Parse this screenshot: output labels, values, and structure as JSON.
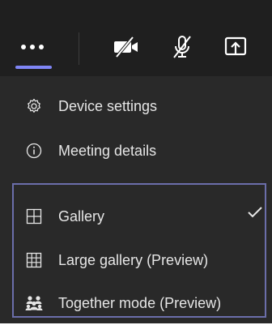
{
  "toolbar": {
    "more": {
      "icon": "more-horizontal-icon",
      "selected": true
    },
    "video": {
      "icon": "video-off-icon"
    },
    "mic": {
      "icon": "mic-off-icon"
    },
    "share": {
      "icon": "share-screen-icon"
    }
  },
  "menu": {
    "items": [
      {
        "label": "Device settings",
        "icon": "gear-icon"
      },
      {
        "label": "Meeting details",
        "icon": "info-icon"
      }
    ],
    "view_options": [
      {
        "label": "Gallery",
        "icon": "gallery-grid-icon",
        "checked": true
      },
      {
        "label": "Large gallery (Preview)",
        "icon": "large-gallery-grid-icon",
        "checked": false
      },
      {
        "label": "Together mode (Preview)",
        "icon": "together-mode-icon",
        "checked": false
      }
    ]
  },
  "colors": {
    "toolbar_bg": "#1f1f1f",
    "menu_bg": "#292929",
    "accent": "#7f85f5",
    "group_border": "#6b6eaa",
    "text": "#e6e6e6"
  }
}
